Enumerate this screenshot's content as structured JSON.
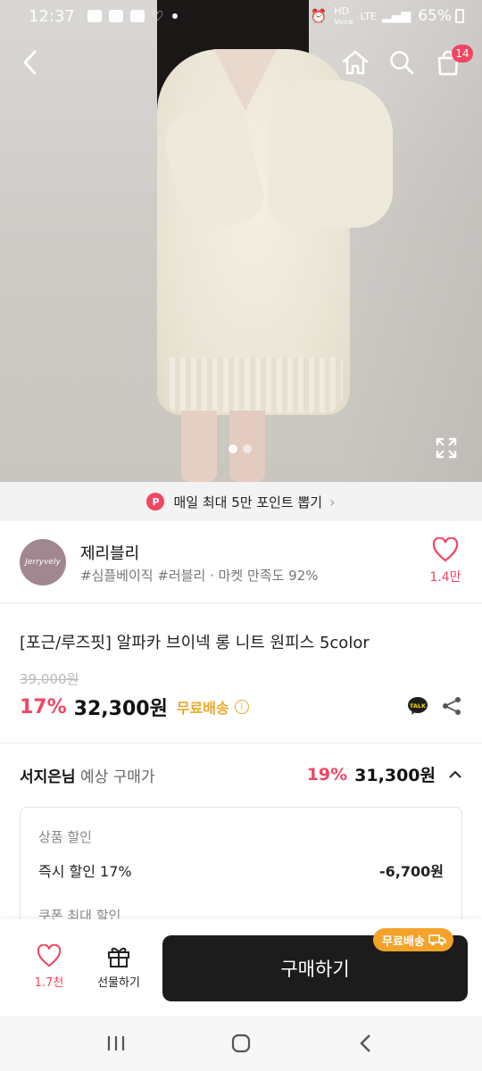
{
  "status_bar": {
    "time": "12:37",
    "hd_label": "HD",
    "voice_label": "Voice",
    "network": "LTE",
    "battery": "65%"
  },
  "cart": {
    "badge_count": "14"
  },
  "gallery": {
    "total_images": 2,
    "current_index": 1
  },
  "banner": {
    "text": "매일 최대 5만 포인트 뽑기",
    "icon_letter": "P"
  },
  "store": {
    "avatar_text": "Jerryvely",
    "name": "제리블리",
    "tags": "#심플베이직 #러블리 · 마켓 만족도 92%",
    "fav_count": "1.4만"
  },
  "product": {
    "title": "[포근/루즈핏] 알파카 브이넥 롱 니트 원피스 5color",
    "original_price": "39,000원",
    "discount": "17%",
    "price": "32,300원",
    "free_shipping": "무료배송"
  },
  "expected": {
    "who": "서지은님",
    "label": "예상 구매가",
    "discount": "19%",
    "price": "31,300원"
  },
  "discount_box": {
    "product_discount_header": "상품 할인",
    "instant_label": "즉시 할인 17%",
    "instant_value": "-6,700원",
    "coupon_header": "쿠폰 최대 할인"
  },
  "actions": {
    "like_count": "1.7천",
    "gift_label": "선물하기",
    "buy_label": "구매하기",
    "ship_chip": "무료배송"
  },
  "colors": {
    "accent": "#f04763",
    "ship": "#e8a92a",
    "buy_bg": "#1c1c1c"
  }
}
